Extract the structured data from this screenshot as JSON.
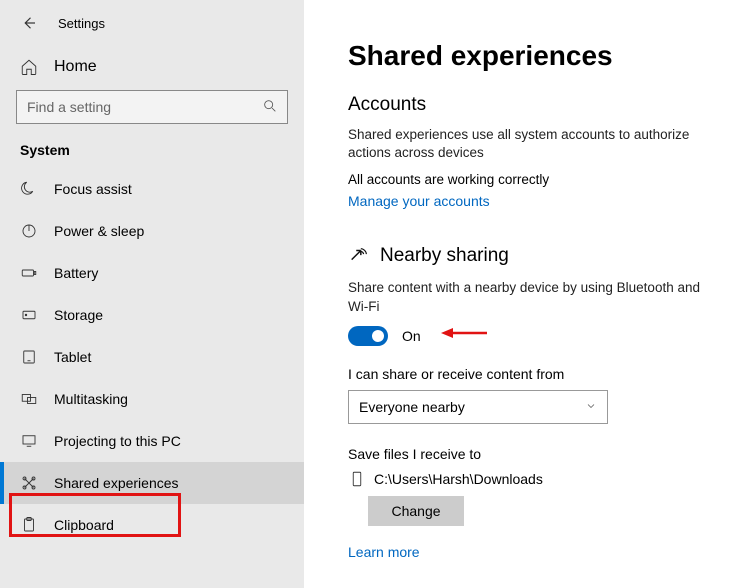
{
  "app_title": "Settings",
  "search_placeholder": "Find a setting",
  "home_label": "Home",
  "category": "System",
  "nav": [
    {
      "label": "Focus assist"
    },
    {
      "label": "Power & sleep"
    },
    {
      "label": "Battery"
    },
    {
      "label": "Storage"
    },
    {
      "label": "Tablet"
    },
    {
      "label": "Multitasking"
    },
    {
      "label": "Projecting to this PC"
    },
    {
      "label": "Shared experiences"
    },
    {
      "label": "Clipboard"
    }
  ],
  "page": {
    "title": "Shared experiences",
    "accounts_heading": "Accounts",
    "accounts_desc": "Shared experiences use all system accounts to authorize actions across devices",
    "accounts_status": "All accounts are working correctly",
    "manage_link": "Manage your accounts",
    "nearby_heading": "Nearby sharing",
    "nearby_desc": "Share content with a nearby device by using Bluetooth and Wi-Fi",
    "toggle_state": "On",
    "share_from_label": "I can share or receive content from",
    "share_from_value": "Everyone nearby",
    "save_to_label": "Save files I receive to",
    "save_to_path": "C:\\Users\\Harsh\\Downloads",
    "change_btn": "Change",
    "learn_more": "Learn more"
  }
}
